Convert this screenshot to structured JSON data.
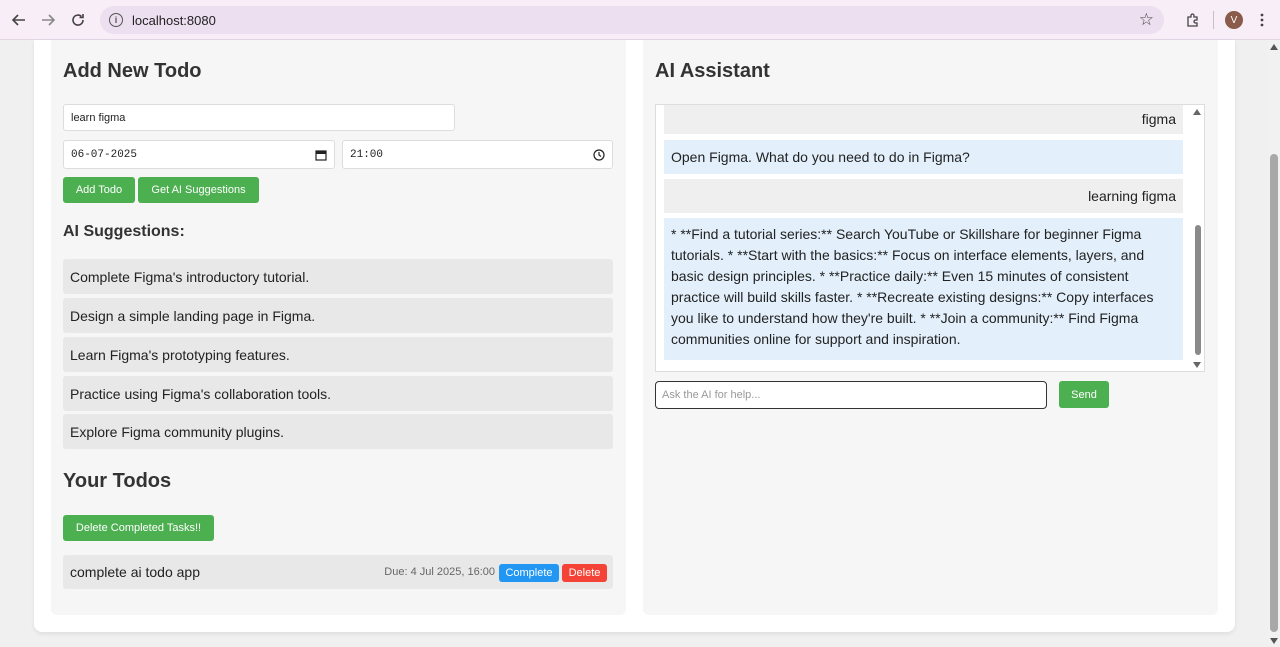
{
  "browser": {
    "url": "localhost:8080",
    "avatar_letter": "V"
  },
  "todo_form": {
    "heading": "Add New Todo",
    "title_value": "learn figma",
    "date_value": "06-07-2025",
    "time_value": "21:00",
    "add_label": "Add Todo",
    "suggest_label": "Get AI Suggestions"
  },
  "suggestions": {
    "heading": "AI Suggestions:",
    "items": [
      "Complete Figma's introductory tutorial.",
      "Design a simple landing page in Figma.",
      "Learn Figma's prototyping features.",
      "Practice using Figma's collaboration tools.",
      "Explore Figma community plugins."
    ]
  },
  "todos": {
    "heading": "Your Todos",
    "delete_completed_label": "Delete Completed Tasks!!",
    "items": [
      {
        "title": "complete ai todo app",
        "due": "Due: 4 Jul 2025, 16:00",
        "complete_label": "Complete",
        "delete_label": "Delete"
      }
    ]
  },
  "assistant": {
    "heading": "AI Assistant",
    "messages": [
      {
        "role": "user",
        "text": "figma"
      },
      {
        "role": "ai",
        "text": "Open Figma. What do you need to do in Figma?"
      },
      {
        "role": "user",
        "text": "learning figma"
      },
      {
        "role": "ai",
        "text": "* **Find a tutorial series:** Search YouTube or Skillshare for beginner Figma tutorials. * **Start with the basics:** Focus on interface elements, layers, and basic design principles. * **Practice daily:** Even 15 minutes of consistent practice will build skills faster. * **Recreate existing designs:** Copy interfaces you like to understand how they're built. * **Join a community:** Find Figma communities online for support and inspiration."
      }
    ],
    "input_placeholder": "Ask the AI for help...",
    "send_label": "Send"
  },
  "colors": {
    "green": "#4caf50",
    "blue": "#2196f3",
    "red": "#f44336",
    "user_bubble": "#efefef",
    "ai_bubble": "#e3f0fb"
  }
}
